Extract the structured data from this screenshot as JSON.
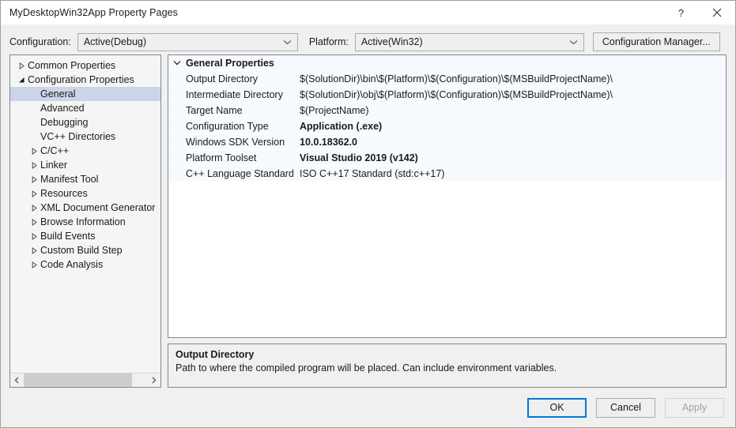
{
  "window": {
    "title": "MyDesktopWin32App Property Pages",
    "help_icon": "help-icon",
    "close_icon": "close-icon"
  },
  "configbar": {
    "configuration_label": "Configuration:",
    "configuration_value": "Active(Debug)",
    "platform_label": "Platform:",
    "platform_value": "Active(Win32)",
    "config_manager_label": "Configuration Manager..."
  },
  "tree": {
    "items": [
      {
        "label": "Common Properties",
        "depth": 0,
        "expander": "collapsed",
        "selected": false
      },
      {
        "label": "Configuration Properties",
        "depth": 0,
        "expander": "expanded",
        "selected": false
      },
      {
        "label": "General",
        "depth": 1,
        "expander": "none",
        "selected": true
      },
      {
        "label": "Advanced",
        "depth": 1,
        "expander": "none",
        "selected": false
      },
      {
        "label": "Debugging",
        "depth": 1,
        "expander": "none",
        "selected": false
      },
      {
        "label": "VC++ Directories",
        "depth": 1,
        "expander": "none",
        "selected": false
      },
      {
        "label": "C/C++",
        "depth": 1,
        "expander": "collapsed",
        "selected": false
      },
      {
        "label": "Linker",
        "depth": 1,
        "expander": "collapsed",
        "selected": false
      },
      {
        "label": "Manifest Tool",
        "depth": 1,
        "expander": "collapsed",
        "selected": false
      },
      {
        "label": "Resources",
        "depth": 1,
        "expander": "collapsed",
        "selected": false
      },
      {
        "label": "XML Document Generator",
        "depth": 1,
        "expander": "collapsed",
        "selected": false
      },
      {
        "label": "Browse Information",
        "depth": 1,
        "expander": "collapsed",
        "selected": false
      },
      {
        "label": "Build Events",
        "depth": 1,
        "expander": "collapsed",
        "selected": false
      },
      {
        "label": "Custom Build Step",
        "depth": 1,
        "expander": "collapsed",
        "selected": false
      },
      {
        "label": "Code Analysis",
        "depth": 1,
        "expander": "collapsed",
        "selected": false
      }
    ],
    "scrollbar": {
      "left_arrow_icon": "chevron-left-icon",
      "right_arrow_icon": "chevron-right-icon"
    }
  },
  "grid": {
    "section_title": "General Properties",
    "section_expander_icon": "chevron-down-icon",
    "rows": [
      {
        "name": "Output Directory",
        "value": "$(SolutionDir)\\bin\\$(Platform)\\$(Configuration)\\$(MSBuildProjectName)\\",
        "bold": false
      },
      {
        "name": "Intermediate Directory",
        "value": "$(SolutionDir)\\obj\\$(Platform)\\$(Configuration)\\$(MSBuildProjectName)\\",
        "bold": false
      },
      {
        "name": "Target Name",
        "value": "$(ProjectName)",
        "bold": false
      },
      {
        "name": "Configuration Type",
        "value": "Application (.exe)",
        "bold": true
      },
      {
        "name": "Windows SDK Version",
        "value": "10.0.18362.0",
        "bold": true
      },
      {
        "name": "Platform Toolset",
        "value": "Visual Studio 2019 (v142)",
        "bold": true
      },
      {
        "name": "C++ Language Standard",
        "value": "ISO C++17 Standard (std:c++17)",
        "bold": false
      }
    ]
  },
  "description": {
    "title": "Output Directory",
    "text": "Path to where the compiled program will be placed. Can include environment variables."
  },
  "footer": {
    "ok_label": "OK",
    "cancel_label": "Cancel",
    "apply_label": "Apply",
    "apply_disabled": true
  },
  "colors": {
    "accent": "#0078D7",
    "selection": "#CCD4E8",
    "window_bg": "#F0F0F0",
    "grid_row": "#F6F9FD"
  }
}
